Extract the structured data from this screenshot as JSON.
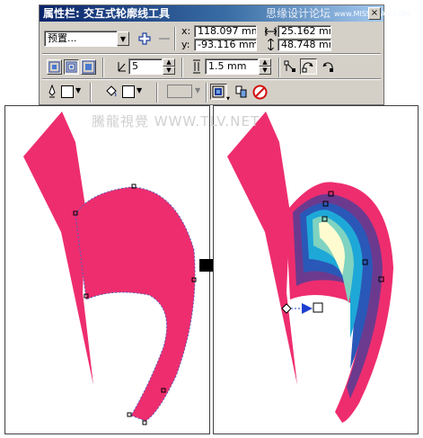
{
  "toolbar": {
    "title": "属性栏: 交互式轮廓线工具",
    "watermark": "思缘设计论坛",
    "watermark_url": "www.MISSYUAN.COM",
    "close_label": "×",
    "preset": "预置...",
    "x_label": "x:",
    "x_value": "118.097 mm",
    "y_label": "y:",
    "y_value": "-93.116 mm",
    "w_value": "25.162 mm",
    "h_value": "48.748 mm",
    "steps_value": "5",
    "offset_value": "1.5 mm",
    "outline_color": "#ffffff",
    "fill_color": "#ffffff",
    "extra_color": "#d4d0c8"
  },
  "canvas": {
    "watermark": "騰龍視覺 WWW.TLV.NET",
    "shape_color": "#ee2d6e",
    "contour_colors": [
      "#ee2d6e",
      "#6b3a8f",
      "#2a58b8",
      "#1ea8d8",
      "#7fd3c0",
      "#fffbd0"
    ]
  }
}
